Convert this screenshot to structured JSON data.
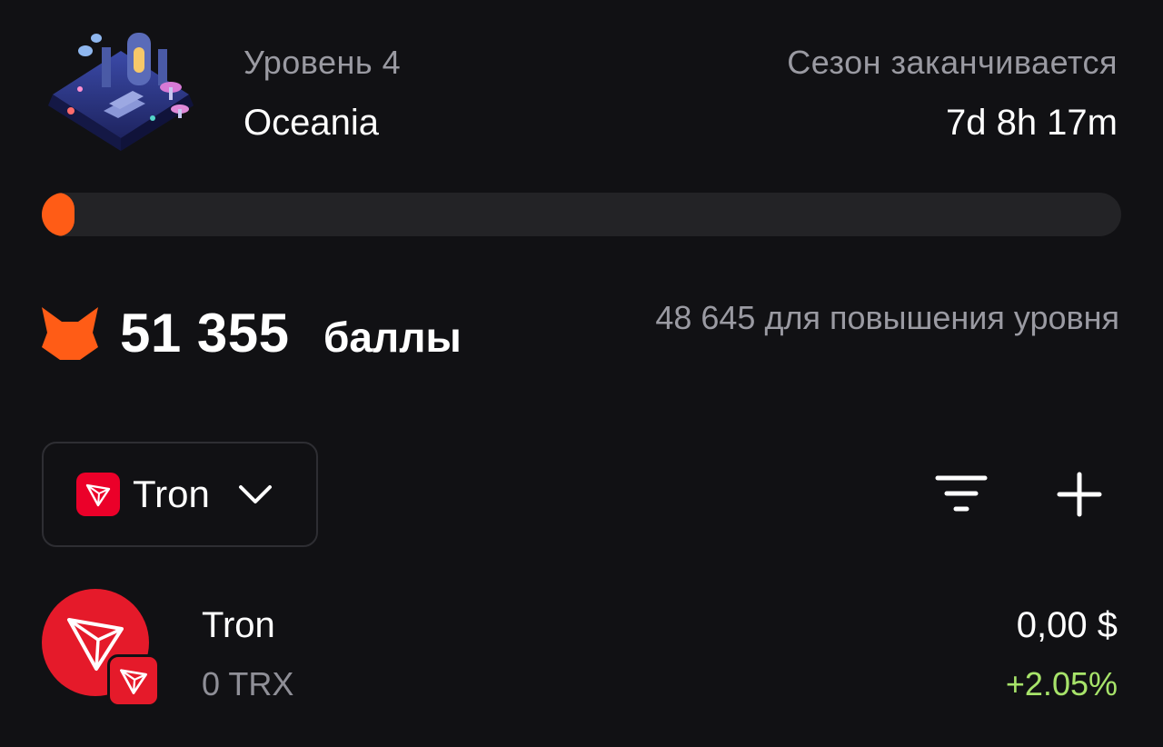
{
  "header": {
    "level_label": "Уровень 4",
    "level_name": "Oceania",
    "season_label": "Сезон заканчивается",
    "season_time": "7d 8h 17m",
    "level_art_icon": "oceania-level-art"
  },
  "progress": {
    "fraction": 0.03,
    "color": "#ff5c16"
  },
  "points": {
    "icon": "fox-icon",
    "value": "51 355",
    "unit": "баллы",
    "next_level": "48 645 для повышения уровня"
  },
  "network_selector": {
    "icon": "tron-icon",
    "selected": "Tron",
    "chevron_icon": "chevron-down-icon"
  },
  "toolbar": {
    "filter_icon": "filter-icon",
    "add_icon": "plus-icon"
  },
  "tokens": [
    {
      "name": "Tron",
      "amount": "0 TRX",
      "fiat": "0,00 $",
      "change": "+2.05%",
      "change_color": "#a7e36a",
      "icon": "tron-icon"
    }
  ],
  "colors": {
    "background": "#111114",
    "accent": "#ff5c16",
    "tron_red": "#e51a2a"
  }
}
